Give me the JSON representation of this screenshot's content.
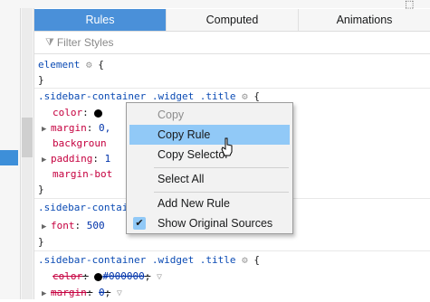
{
  "tabs": [
    {
      "label": "Rules"
    },
    {
      "label": "Computed"
    },
    {
      "label": "Animations"
    }
  ],
  "filter": {
    "placeholder": "Filter Styles"
  },
  "rules": {
    "element": {
      "selector": "element",
      "open": "{",
      "close": "}"
    },
    "rule1": {
      "selector": ".sidebar-container .widget .title",
      "open": "{",
      "close": "}",
      "decls": [
        {
          "prop": "color",
          "colon": ":",
          "value": "",
          "semi": ""
        },
        {
          "prop": "margin",
          "colon": ":",
          "value": "0,",
          "semi": ""
        },
        {
          "prop": "backgroun",
          "colon": "",
          "value": "",
          "semi": ""
        },
        {
          "prop": "padding",
          "colon": ":",
          "value": "1",
          "semi": ""
        },
        {
          "prop": "margin-bot",
          "colon": "",
          "value": "",
          "semi": ""
        }
      ]
    },
    "rule2": {
      "selector": ".sidebar-contai",
      "open": "",
      "close": "}",
      "decls": [
        {
          "prop": "font",
          "colon": ":",
          "value": "500",
          "semi": ""
        }
      ]
    },
    "rule3": {
      "selector": ".sidebar-container .widget .title",
      "open": "{",
      "decls": [
        {
          "prop": "color",
          "colon": ":",
          "value": "#000000",
          "semi": ";"
        },
        {
          "prop": "margin",
          "colon": ":",
          "value": "0",
          "semi": ";"
        }
      ]
    }
  },
  "context_menu": {
    "items": [
      {
        "label": "Copy",
        "state": "disabled"
      },
      {
        "label": "Copy Rule",
        "state": "hover"
      },
      {
        "label": "Copy Selector",
        "state": "normal"
      },
      {
        "label": "Select All",
        "state": "normal"
      },
      {
        "label": "Add New Rule",
        "state": "normal"
      },
      {
        "label": "Show Original Sources",
        "state": "checked"
      }
    ]
  },
  "colors": {
    "active_tab": "#4a90d9",
    "menu_hover": "#91c9f7",
    "selector": "#0b4bb4",
    "property": "#c5003f"
  },
  "icons": [
    "layout-toggle-icon",
    "filter-icon",
    "gear-icon",
    "color-swatch-icon",
    "twisty-icon",
    "funnel-icon",
    "checkmark-icon",
    "mouse-pointer-icon"
  ]
}
